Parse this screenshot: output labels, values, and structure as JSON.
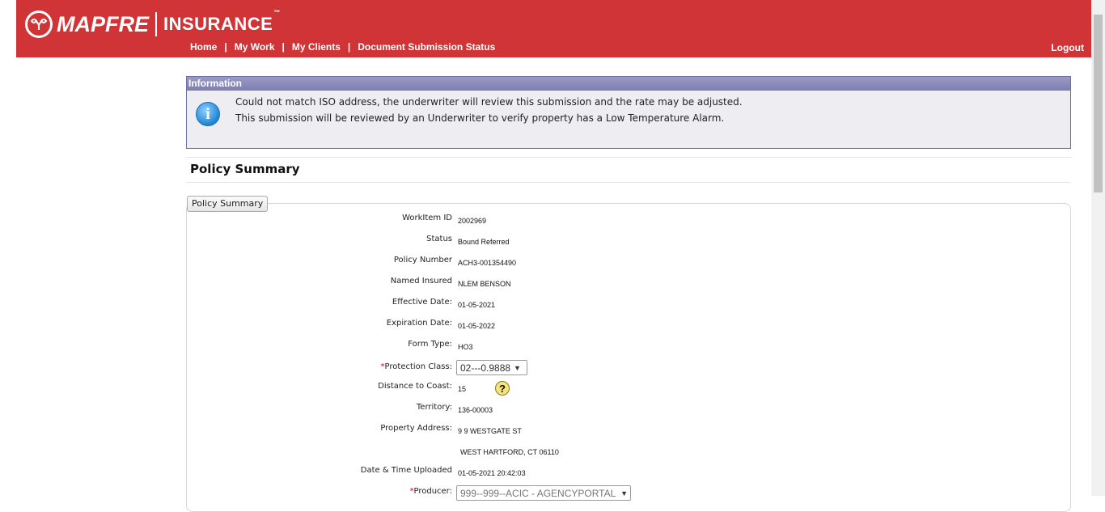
{
  "brand": {
    "name": "MAPFRE",
    "sub": "INSURANCE",
    "tm": "™"
  },
  "nav": {
    "items": [
      "Home",
      "My Work",
      "My Clients",
      "Document Submission Status"
    ],
    "separator": "|",
    "logout": "Logout"
  },
  "info": {
    "title": "Information",
    "line1": "Could not match ISO address, the underwriter will review this submission and the rate may be adjusted.",
    "line2": "This submission will be reviewed by an Underwriter to verify property has a Low Temperature Alarm."
  },
  "page_title": "Policy Summary",
  "legend": "Policy Summary",
  "fields": {
    "workitem_label": "WorkItem ID",
    "workitem_value": "2002969",
    "status_label": "Status",
    "status_value": "Bound Referred",
    "policy_label": "Policy Number",
    "policy_value": "ACH3-001354490",
    "insured_label": "Named Insured",
    "insured_value": "NLEM BENSON",
    "eff_label": "Effective Date:",
    "eff_value": "01-05-2021",
    "exp_label": "Expiration Date:",
    "exp_value": "01-05-2022",
    "form_label": "Form Type:",
    "form_value": "HO3",
    "protection_label": "Protection Class:",
    "protection_value": "02---0.9888",
    "coast_label": "Distance to Coast:",
    "coast_value": "15",
    "territory_label": "Territory:",
    "territory_value": "136-00003",
    "address_label": "Property Address:",
    "address_line1": "9 9 WESTGATE ST",
    "address_line2": "WEST HARTFORD, CT 06110",
    "uploaded_label": "Date & Time Uploaded",
    "uploaded_value": "01-05-2021 20:42:03",
    "producer_label": "Producer:",
    "producer_value": "999--999--ACIC - AGENCYPORTAL"
  },
  "required_mark": "*",
  "help_glyph": "?",
  "colors": {
    "header": "#d03436",
    "info_header": "#8686b9",
    "info_bg": "#eeeef2"
  }
}
